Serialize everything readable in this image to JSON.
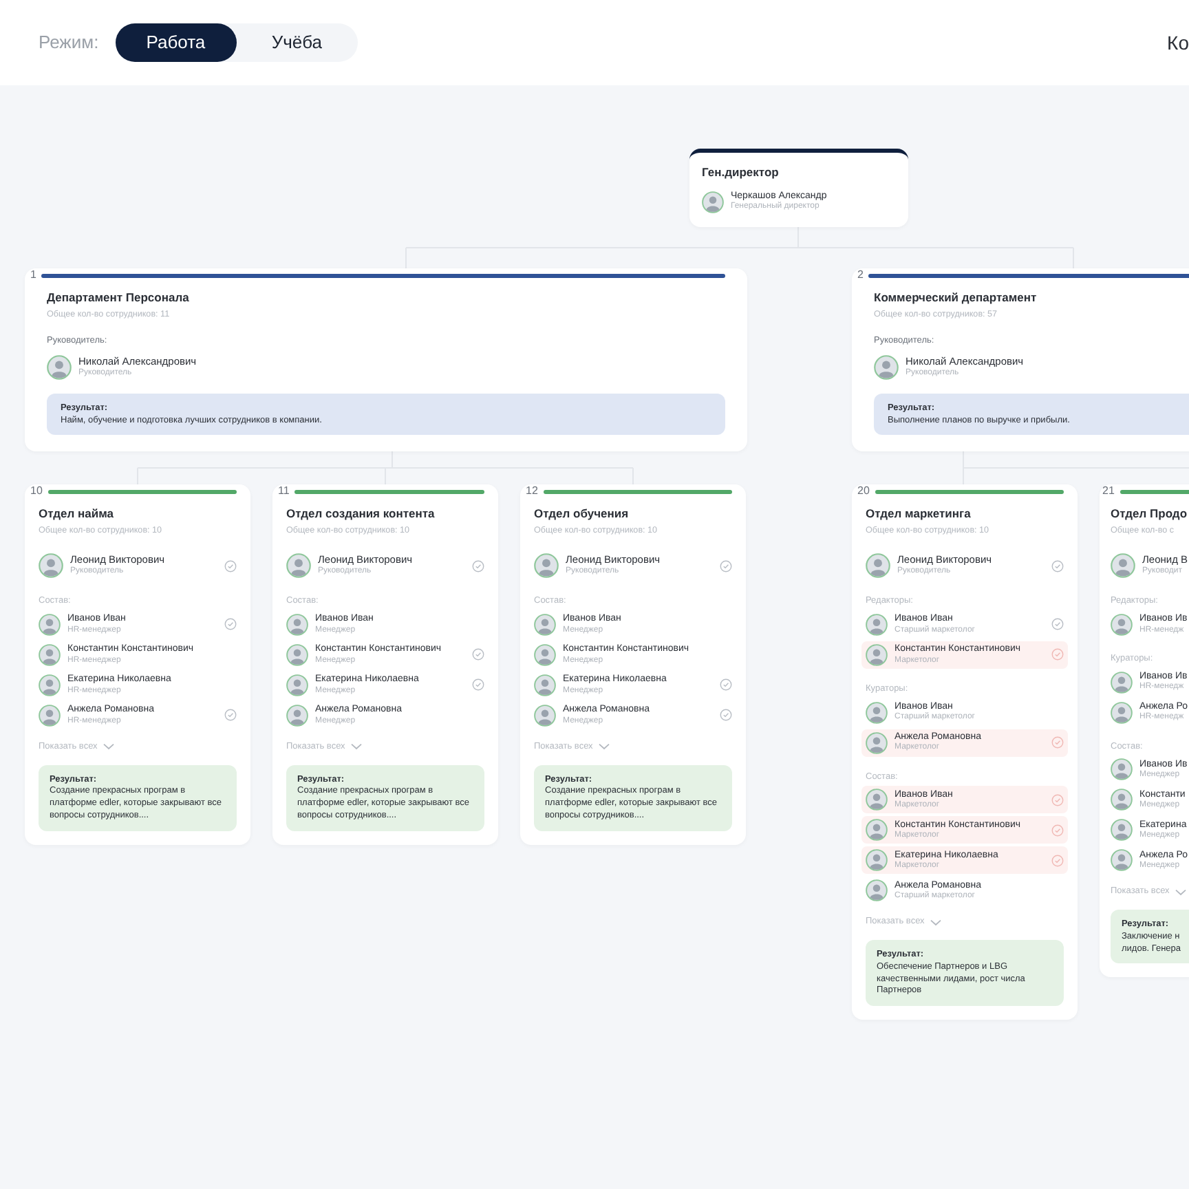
{
  "header": {
    "mode_label": "Режим:",
    "modes": [
      {
        "label": "Работа",
        "selected": true
      },
      {
        "label": "Учёба",
        "selected": false
      }
    ],
    "right_text": "Ко"
  },
  "ceo": {
    "title": "Ген.директор",
    "name": "Черкашов Александр",
    "role": "Генеральный директор"
  },
  "departments": [
    {
      "number": "1",
      "title": "Департамент Персонала",
      "count": "Общее кол-во сотрудников: 11",
      "head_label": "Руководитель:",
      "head": {
        "name": "Николай Александрович",
        "role": "Руководитель"
      },
      "result_label": "Результат:",
      "result": "Найм, обучение и подготовка лучших сотрудников в компании."
    },
    {
      "number": "2",
      "title": "Коммерческий департамент",
      "count": "Общее кол-во сотрудников: 57",
      "head_label": "Руководитель:",
      "head": {
        "name": "Николай Александрович",
        "role": "Руководитель"
      },
      "result_label": "Результат:",
      "result": "Выполнение планов по выручке и прибыли."
    }
  ],
  "units": [
    {
      "number": "10",
      "title": "Отдел найма",
      "count": "Общее кол-во сотрудников: 10",
      "leader": {
        "name": "Леонид Викторович",
        "role": "Руководитель",
        "checked": true,
        "highlighted": false
      },
      "groups": [
        {
          "label": "Состав:",
          "members": [
            {
              "name": "Иванов Иван",
              "role": "HR-менеджер",
              "checked": true,
              "highlighted": false
            },
            {
              "name": "Константин Константинович",
              "role": "HR-менеджер",
              "checked": false,
              "highlighted": false
            },
            {
              "name": "Екатерина Николаевна",
              "role": "HR-менеджер",
              "checked": false,
              "highlighted": false
            },
            {
              "name": "Анжела Романовна",
              "role": "HR-менеджер",
              "checked": true,
              "highlighted": false
            }
          ]
        }
      ],
      "show_all": "Показать всех",
      "result_label": "Результат:",
      "result": "Создание прекрасных програм в платформе edler, которые закрывают все вопросы сотрудников...."
    },
    {
      "number": "11",
      "title": "Отдел создания контента",
      "count": "Общее кол-во сотрудников: 10",
      "leader": {
        "name": "Леонид Викторович",
        "role": "Руководитель",
        "checked": true,
        "highlighted": false
      },
      "groups": [
        {
          "label": "Состав:",
          "members": [
            {
              "name": "Иванов Иван",
              "role": "Менеджер",
              "checked": false,
              "highlighted": false
            },
            {
              "name": "Константин Константинович",
              "role": "Менеджер",
              "checked": true,
              "highlighted": false
            },
            {
              "name": "Екатерина Николаевна",
              "role": "Менеджер",
              "checked": true,
              "highlighted": false
            },
            {
              "name": "Анжела Романовна",
              "role": "Менеджер",
              "checked": false,
              "highlighted": false
            }
          ]
        }
      ],
      "show_all": "Показать всех",
      "result_label": "Результат:",
      "result": "Создание прекрасных програм в платформе edler, которые закрывают все вопросы сотрудников...."
    },
    {
      "number": "12",
      "title": "Отдел обучения",
      "count": "Общее кол-во сотрудников: 10",
      "leader": {
        "name": "Леонид Викторович",
        "role": "Руководитель",
        "checked": true,
        "highlighted": false
      },
      "groups": [
        {
          "label": "Состав:",
          "members": [
            {
              "name": "Иванов Иван",
              "role": "Менеджер",
              "checked": false,
              "highlighted": false
            },
            {
              "name": "Константин Константинович",
              "role": "Менеджер",
              "checked": false,
              "highlighted": false
            },
            {
              "name": "Екатерина Николаевна",
              "role": "Менеджер",
              "checked": true,
              "highlighted": false
            },
            {
              "name": "Анжела Романовна",
              "role": "Менеджер",
              "checked": true,
              "highlighted": false
            }
          ]
        }
      ],
      "show_all": "Показать всех",
      "result_label": "Результат:",
      "result": "Создание прекрасных програм в платформе edler, которые закрывают все вопросы сотрудников...."
    },
    {
      "number": "20",
      "title": "Отдел маркетинга",
      "count": "Общее кол-во сотрудников: 10",
      "leader": {
        "name": "Леонид Викторович",
        "role": "Руководитель",
        "checked": true,
        "highlighted": false
      },
      "groups": [
        {
          "label": "Редакторы:",
          "members": [
            {
              "name": "Иванов Иван",
              "role": "Старший маркетолог",
              "checked": true,
              "highlighted": false
            },
            {
              "name": "Константин Константинович",
              "role": "Маркетолог",
              "checked": true,
              "highlighted": true
            }
          ]
        },
        {
          "label": "Кураторы:",
          "members": [
            {
              "name": "Иванов Иван",
              "role": "Старший маркетолог",
              "checked": false,
              "highlighted": false
            },
            {
              "name": "Анжела Романовна",
              "role": "Маркетолог",
              "checked": true,
              "highlighted": true
            }
          ]
        },
        {
          "label": "Состав:",
          "members": [
            {
              "name": "Иванов Иван",
              "role": "Маркетолог",
              "checked": true,
              "highlighted": true
            },
            {
              "name": "Константин Константинович",
              "role": "Маркетолог",
              "checked": true,
              "highlighted": true
            },
            {
              "name": "Екатерина Николаевна",
              "role": "Маркетолог",
              "checked": true,
              "highlighted": true
            },
            {
              "name": "Анжела Романовна",
              "role": "Старший маркетолог",
              "checked": false,
              "highlighted": false
            }
          ]
        }
      ],
      "show_all": "Показать всех",
      "result_label": "Результат:",
      "result": "Обеспечение Партнеров и LBG качественными лидами, рост числа Партнеров"
    },
    {
      "number": "21",
      "title": "Отдел Продо",
      "count": "Общее кол-во с",
      "leader": {
        "name": "Леонид В",
        "role": "Руководит",
        "highlighted": false
      },
      "groups": [
        {
          "label": "Редакторы:",
          "members": [
            {
              "name": "Иванов Ив",
              "role": "HR-менедж",
              "highlighted": false
            }
          ]
        },
        {
          "label": "Кураторы:",
          "members": [
            {
              "name": "Иванов Ив",
              "role": "HR-менедж",
              "highlighted": false
            },
            {
              "name": "Анжела Ро",
              "role": "HR-менедж",
              "highlighted": false
            }
          ]
        },
        {
          "label": "Состав:",
          "members": [
            {
              "name": "Иванов Ив",
              "role": "Менеджер",
              "highlighted": false
            },
            {
              "name": "Константи",
              "role": "Менеджер",
              "highlighted": false
            },
            {
              "name": "Екатерина",
              "role": "Менеджер",
              "highlighted": false
            },
            {
              "name": "Анжела Ро",
              "role": "Менеджер",
              "highlighted": false
            }
          ]
        }
      ],
      "show_all": "Показать всех",
      "result_label": "Результат:",
      "result": "Заключение н лидов. Генера"
    }
  ]
}
